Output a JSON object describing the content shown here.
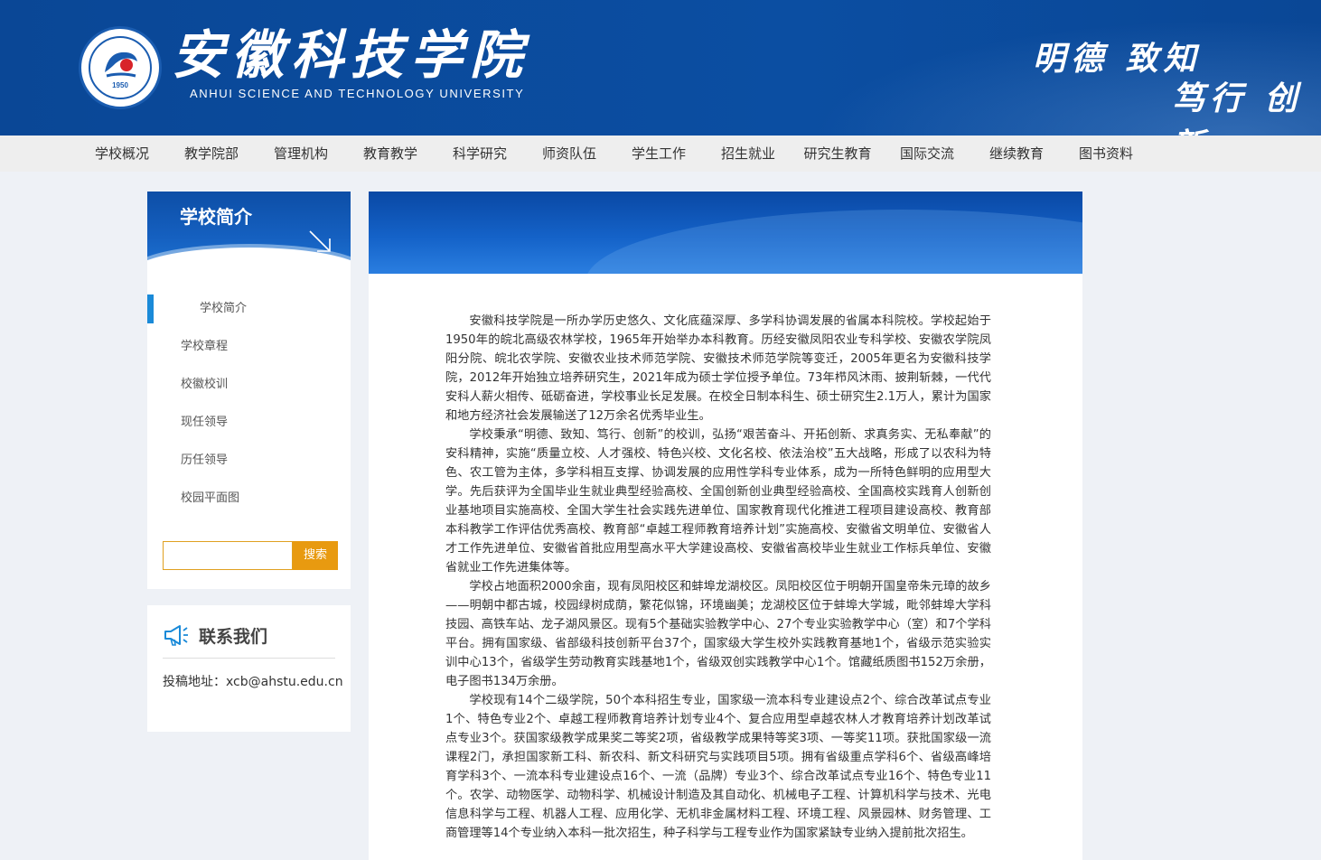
{
  "header": {
    "title": "安徽科技学院",
    "subtitle": "ANHUI SCIENCE AND TECHNOLOGY UNIVERSITY",
    "emblem_year": "1950",
    "motto_line1": "明德 致知",
    "motto_line2": "笃行 创新",
    "colors": {
      "header_bg": "#0b4ea2",
      "accent": "#e89a10",
      "active_bar": "#1a8ad8"
    }
  },
  "nav": {
    "items": [
      "学校概况",
      "教学院部",
      "管理机构",
      "教育教学",
      "科学研究",
      "师资队伍",
      "学生工作",
      "招生就业",
      "研究生教育",
      "国际交流",
      "继续教育",
      "图书资料"
    ]
  },
  "sidebar": {
    "title": "学校简介",
    "items": [
      {
        "label": "学校简介",
        "active": true
      },
      {
        "label": "学校章程",
        "active": false
      },
      {
        "label": "校徽校训",
        "active": false
      },
      {
        "label": "现任领导",
        "active": false
      },
      {
        "label": "历任领导",
        "active": false
      },
      {
        "label": "校园平面图",
        "active": false
      }
    ],
    "search": {
      "placeholder": "",
      "button_label": "搜索"
    }
  },
  "contact": {
    "title": "联系我们",
    "address": "投稿地址：xcb@ahstu.edu.cn",
    "icon": "megaphone-icon"
  },
  "article": {
    "paragraphs": [
      "安徽科技学院是一所办学历史悠久、文化底蕴深厚、多学科协调发展的省属本科院校。学校起始于1950年的皖北高级农林学校，1965年开始举办本科教育。历经安徽凤阳农业专科学校、安徽农学院凤阳分院、皖北农学院、安徽农业技术师范学院、安徽技术师范学院等变迁，2005年更名为安徽科技学院，2012年开始独立培养研究生，2021年成为硕士学位授予单位。73年栉风沐雨、披荆斩棘，一代代安科人薪火相传、砥砺奋进，学校事业长足发展。在校全日制本科生、硕士研究生2.1万人，累计为国家和地方经济社会发展输送了12万余名优秀毕业生。",
      "学校秉承“明德、致知、笃行、创新”的校训，弘扬“艰苦奋斗、开拓创新、求真务实、无私奉献”的安科精神，实施“质量立校、人才强校、特色兴校、文化名校、依法治校”五大战略，形成了以农科为特色、农工管为主体，多学科相互支撑、协调发展的应用性学科专业体系，成为一所特色鲜明的应用型大学。先后获评为全国毕业生就业典型经验高校、全国创新创业典型经验高校、全国高校实践育人创新创业基地项目实施高校、全国大学生社会实践先进单位、国家教育现代化推进工程项目建设高校、教育部本科教学工作评估优秀高校、教育部“卓越工程师教育培养计划”实施高校、安徽省文明单位、安徽省人才工作先进单位、安徽省首批应用型高水平大学建设高校、安徽省高校毕业生就业工作标兵单位、安徽省就业工作先进集体等。",
      "学校占地面积2000余亩，现有凤阳校区和蚌埠龙湖校区。凤阳校区位于明朝开国皇帝朱元璋的故乡——明朝中都古城，校园绿树成荫，繁花似锦，环境幽美；龙湖校区位于蚌埠大学城，毗邻蚌埠大学科技园、高铁车站、龙子湖风景区。现有5个基础实验教学中心、27个专业实验教学中心（室）和7个学科平台。拥有国家级、省部级科技创新平台37个，国家级大学生校外实践教育基地1个，省级示范实验实训中心13个，省级学生劳动教育实践基地1个，省级双创实践教学中心1个。馆藏纸质图书152万余册，电子图书134万余册。",
      "学校现有14个二级学院，50个本科招生专业，国家级一流本科专业建设点2个、综合改革试点专业1个、特色专业2个、卓越工程师教育培养计划专业4个、复合应用型卓越农林人才教育培养计划改革试点专业3个。获国家级教学成果奖二等奖2项，省级教学成果特等奖3项、一等奖11项。获批国家级一流课程2门，承担国家新工科、新农科、新文科研究与实践项目5项。拥有省级重点学科6个、省级高峰培育学科3个、一流本科专业建设点16个、一流（品牌）专业3个、综合改革试点专业16个、特色专业11个。农学、动物医学、动物科学、机械设计制造及其自动化、机械电子工程、计算机科学与技术、光电信息科学与工程、机器人工程、应用化学、无机非金属材料工程、环境工程、风景园林、财务管理、工商管理等14个专业纳入本科一批次招生，种子科学与工程专业作为国家紧缺专业纳入提前批次招生。"
    ]
  }
}
